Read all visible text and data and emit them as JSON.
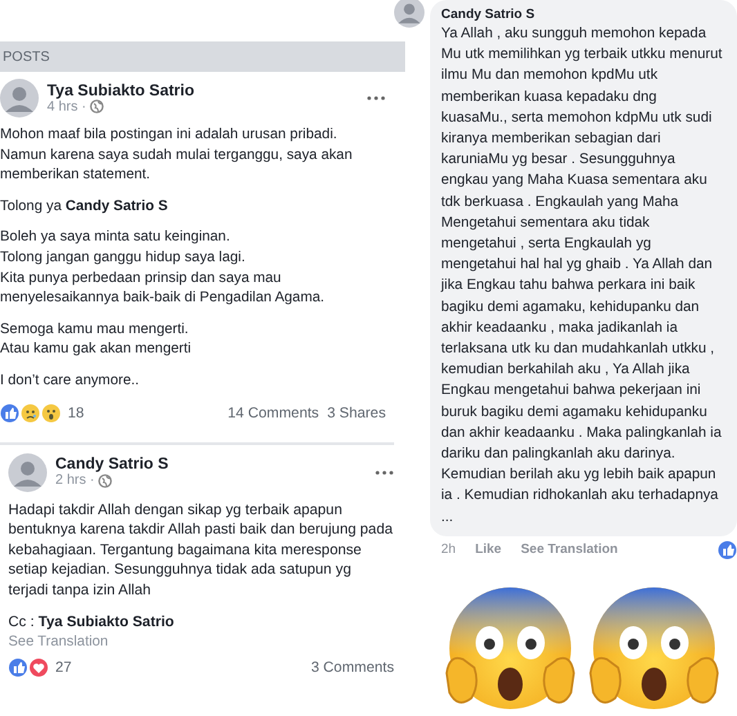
{
  "posts_header": "POSTS",
  "posts": [
    {
      "author": "Tya Subiakto Satrio",
      "time": "4 hrs ·",
      "paragraphs": [
        "Mohon maaf bila postingan ini adalah urusan pribadi. Namun karena saya sudah mulai terganggu, saya akan memberikan statement.",
        "Tolong ya **Candy Satrio S**",
        "Boleh ya saya minta satu keinginan.\nTolong jangan ganggu hidup saya lagi.\nKita punya perbedaan prinsip dan saya mau\nmenyelesaikannya baik-baik di Pengadilan Agama.",
        "Semoga kamu mau mengerti.\nAtau kamu gak akan mengerti",
        "I don’t care anymore.."
      ],
      "reactions": [
        {
          "kind": "like"
        },
        {
          "kind": "sad"
        },
        {
          "kind": "wow"
        }
      ],
      "reaction_count": "18",
      "comments": "14 Comments",
      "shares": "3 Shares"
    },
    {
      "author": "Candy Satrio S",
      "time": "2 hrs ·",
      "paragraphs": [
        "Hadapi takdir Allah dengan sikap yg terbaik apapun bentuknya karena takdir Allah pasti baik dan berujung pada kebahagiaan. Tergantung bagaimana kita meresponse setiap kejadian. Sesungguhnya tidak ada satupun yg terjadi tanpa izin Allah",
        "Cc : **Tya Subiakto Satrio**"
      ],
      "see_translation": "See Translation",
      "reactions": [
        {
          "kind": "like"
        },
        {
          "kind": "love"
        }
      ],
      "reaction_count": "27",
      "comments": "3 Comments"
    }
  ],
  "comment": {
    "author": "Candy Satrio S",
    "text": "Ya Allah , aku sungguh memohon kepada Mu utk memilihkan yg terbaik utkku menurut ilmu Mu dan memohon kpdMu utk memberikan kuasa kepadaku dng kuasaMu., serta memohon kdpMu utk sudi kiranya memberikan sebagian dari karuniaMu yg besar . Sesungguhnya engkau yang Maha Kuasa sementara aku tdk berkuasa . Engkaulah yang Maha Mengetahui sementara aku tidak mengetahui , serta Engkaulah yg mengetahui hal hal yg ghaib . Ya Allah dan jika Engkau tahu bahwa perkara ini baik bagiku demi agamaku,  kehidupanku dan akhir keadaanku , maka jadikanlah ia terlaksana utk ku dan mudahkanlah utkku , kemudian berkahilah aku , Ya Allah jika Engkau mengetahui bahwa pekerjaan ini buruk bagiku demi agamaku kehidupanku dan akhir keadaanku . Maka palingkanlah ia dariku dan palingkanlah aku darinya. Kemudian berilah aku yg lebih baik apapun ia . Kemudian ridhokanlah aku terhadapnya ...",
    "time": "2h",
    "like": "Like",
    "see_translation": "See Translation",
    "reactions": [
      {
        "kind": "like"
      }
    ]
  },
  "emojis": [
    {
      "kind": "screaming"
    },
    {
      "kind": "screaming"
    }
  ]
}
